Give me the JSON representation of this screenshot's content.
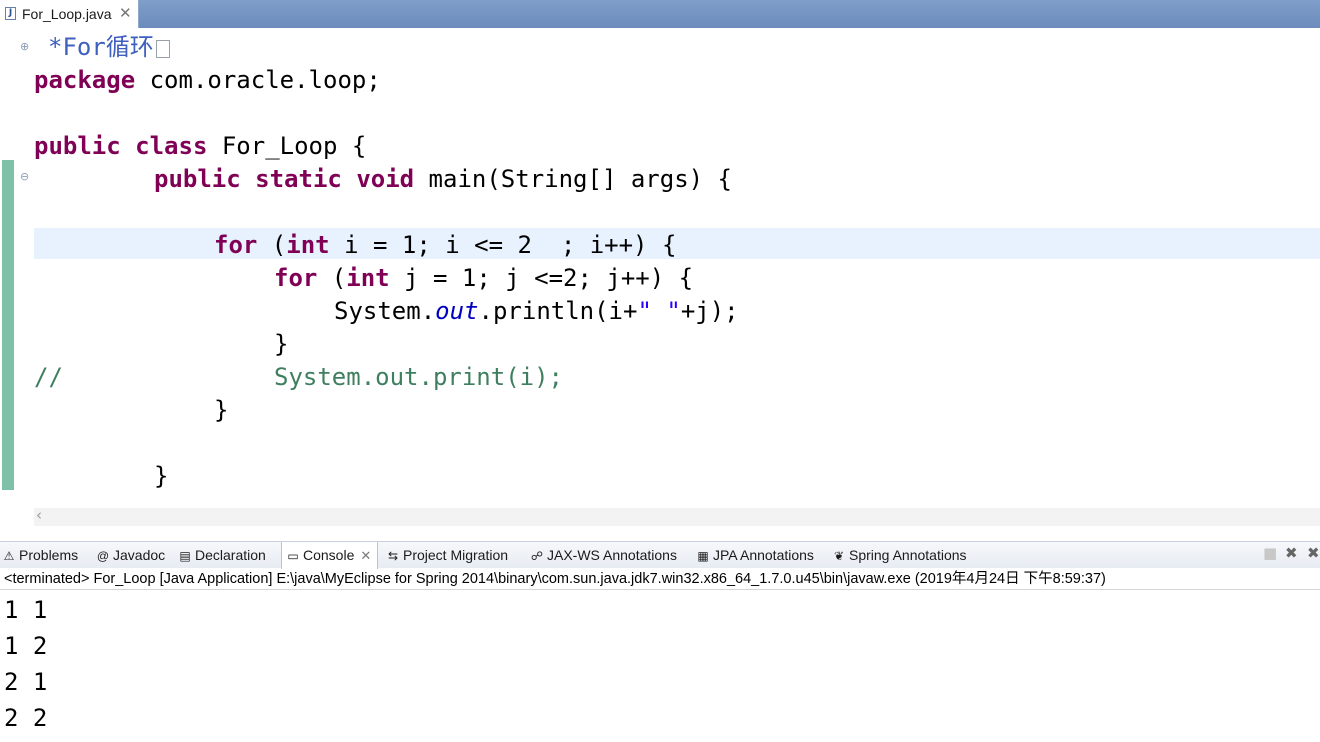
{
  "editor_tab": {
    "label": "For_Loop.java",
    "icon": "java-file-icon",
    "close": "✕"
  },
  "code": {
    "folded_comment": "*For循环",
    "package_kw": "package",
    "package_name": " com.oracle.loop;",
    "public1": "public",
    "class_kw": "class",
    "class_rest": " For_Loop {",
    "public2": "public",
    "static_kw": "static",
    "void_kw": "void",
    "main_rest": " main(String[] args) {",
    "for1_kw": "for",
    "for1_a": " (",
    "int1": "int",
    "for1_b": " i = 1; i <= 2  ; i++) {",
    "for2_kw": "for",
    "for2_a": " (",
    "int2": "int",
    "for2_b": " j = 1; j <=2; j++) {",
    "print_a": "System.",
    "print_out": "out",
    "print_b": ".println(i+",
    "print_str": "\" \"",
    "print_c": "+j);",
    "brace_inner": "}",
    "comment_slashes": "//",
    "comment_code": "System.out.print(i);",
    "brace_for": "}",
    "brace_main": "}"
  },
  "views": {
    "tabs": [
      {
        "label": "Problems",
        "icon": "problems-icon"
      },
      {
        "label": "Javadoc",
        "icon": "at-icon"
      },
      {
        "label": "Declaration",
        "icon": "declaration-icon"
      },
      {
        "label": "Console",
        "icon": "console-icon",
        "close": "✕"
      },
      {
        "label": "Project Migration",
        "icon": "migration-icon"
      },
      {
        "label": "JAX-WS Annotations",
        "icon": "jaxws-icon"
      },
      {
        "label": "JPA Annotations",
        "icon": "jpa-icon"
      },
      {
        "label": "Spring Annotations",
        "icon": "spring-icon"
      }
    ]
  },
  "console": {
    "header": "<terminated> For_Loop [Java Application] E:\\java\\MyEclipse for Spring 2014\\binary\\com.sun.java.jdk7.win32.x86_64_1.7.0.u45\\bin\\javaw.exe (2019年4月24日 下午8:59:37)",
    "output": [
      "1 1",
      "1 2",
      "2 1",
      "2 2"
    ]
  },
  "colors": {
    "keyword": "#7f0055",
    "comment": "#3f7f5f",
    "field": "#0000c0",
    "string": "#2a00ff",
    "javadoc": "#3f5fbf"
  }
}
